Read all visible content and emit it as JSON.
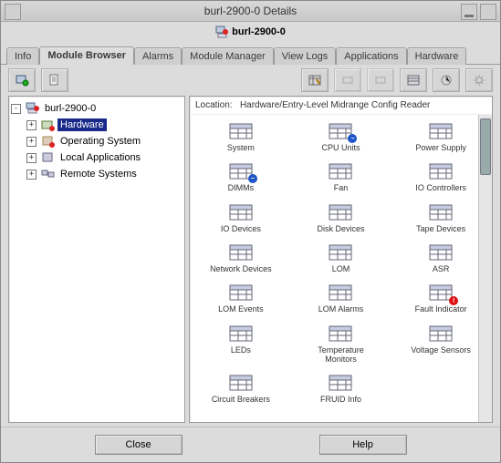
{
  "window": {
    "title": "burl-2900-0 Details"
  },
  "host": {
    "name": "burl-2900-0"
  },
  "tabs": [
    {
      "id": "info",
      "label": "Info"
    },
    {
      "id": "mod",
      "label": "Module Browser",
      "active": true
    },
    {
      "id": "alarms",
      "label": "Alarms"
    },
    {
      "id": "modmgr",
      "label": "Module Manager"
    },
    {
      "id": "logs",
      "label": "View Logs"
    },
    {
      "id": "apps",
      "label": "Applications"
    },
    {
      "id": "hw",
      "label": "Hardware"
    }
  ],
  "tree": {
    "root": {
      "label": "burl-2900-0",
      "expander": "-"
    },
    "children": [
      {
        "label": "Hardware",
        "expander": "+",
        "selected": true,
        "icon": "hw",
        "badge": "red"
      },
      {
        "label": "Operating System",
        "expander": "+",
        "icon": "os",
        "badge": "red"
      },
      {
        "label": "Local Applications",
        "expander": "+",
        "icon": "la"
      },
      {
        "label": "Remote Systems",
        "expander": "+",
        "icon": "rs"
      }
    ]
  },
  "location": {
    "prefix": "Location:",
    "path": "Hardware/Entry-Level Midrange Config Reader"
  },
  "grid": [
    {
      "label": "System"
    },
    {
      "label": "CPU Units",
      "badge": "blue"
    },
    {
      "label": "Power Supply"
    },
    {
      "label": "DIMMs",
      "badge": "blue"
    },
    {
      "label": "Fan"
    },
    {
      "label": "IO Controllers"
    },
    {
      "label": "IO Devices"
    },
    {
      "label": "Disk Devices"
    },
    {
      "label": "Tape Devices"
    },
    {
      "label": "Network Devices"
    },
    {
      "label": "LOM"
    },
    {
      "label": "ASR"
    },
    {
      "label": "LOM Events"
    },
    {
      "label": "LOM Alarms"
    },
    {
      "label": "Fault Indicator",
      "badge": "red"
    },
    {
      "label": "LEDs"
    },
    {
      "label": "Temperature Monitors"
    },
    {
      "label": "Voltage Sensors"
    },
    {
      "label": "Circuit Breakers"
    },
    {
      "label": "FRUID Info"
    }
  ],
  "buttons": {
    "close": "Close",
    "help": "Help"
  }
}
